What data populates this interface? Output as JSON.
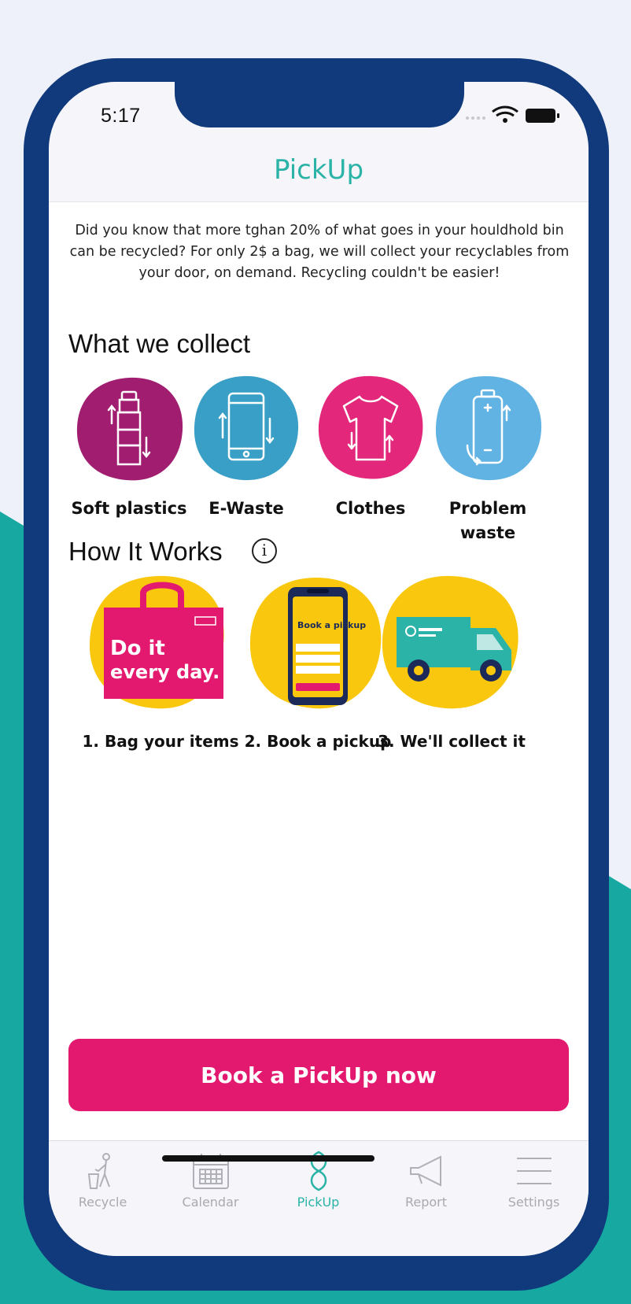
{
  "status_bar": {
    "time": "5:17"
  },
  "header": {
    "title": "PickUp"
  },
  "intro": {
    "text": "Did you know that more tghan 20% of what goes in your houldhold bin can be recycled? For only 2$ a bag, we will collect your recyclables from your door, on demand. Recycling couldn't be easier!"
  },
  "collect": {
    "title": "What we collect",
    "items": [
      {
        "label": "Soft plastics",
        "icon": "bottle-icon",
        "color": "#a01d6f"
      },
      {
        "label": "E-Waste",
        "icon": "phone-icon",
        "color": "#3a9fc6"
      },
      {
        "label": "Clothes",
        "icon": "tshirt-icon",
        "color": "#e3287c"
      },
      {
        "label": "Problem waste",
        "icon": "battery-icon",
        "color": "#61b3e3"
      }
    ]
  },
  "how": {
    "title": "How It Works",
    "steps": [
      {
        "label": "1. Bag your items",
        "bag_text_1": "Do it",
        "bag_text_2": "every day."
      },
      {
        "label": "2. Book a pickup",
        "phone_text": "Book a pickup"
      },
      {
        "label": "3. We'll collect it"
      }
    ]
  },
  "cta": {
    "label": "Book a PickUp now",
    "color": "#e3196f"
  },
  "tabs": [
    {
      "label": "Recycle",
      "icon": "recycle-person-icon",
      "active": false
    },
    {
      "label": "Calendar",
      "icon": "calendar-icon",
      "active": false
    },
    {
      "label": "PickUp",
      "icon": "pickup-icon",
      "active": true
    },
    {
      "label": "Report",
      "icon": "megaphone-icon",
      "active": false
    },
    {
      "label": "Settings",
      "icon": "menu-icon",
      "active": false
    }
  ],
  "colors": {
    "accent": "#2ab3a6",
    "frame": "#113a7c",
    "step_blob": "#f9c80e"
  }
}
